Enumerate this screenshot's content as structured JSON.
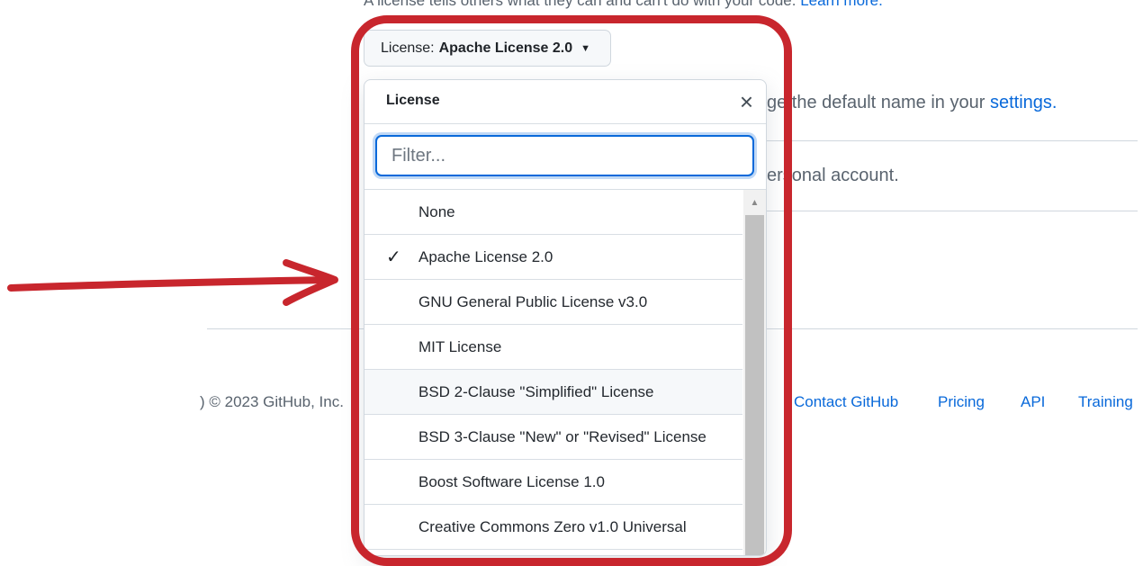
{
  "background": {
    "top_text": "A license tells others what they can and can't do with your code.",
    "top_link": "Learn more.",
    "line1_text": "ge the default name in your",
    "line1_link": "settings.",
    "line2_text": "ersonal account.",
    "footer": {
      "copyright": ") © 2023 GitHub, Inc.",
      "links": [
        "Contact GitHub",
        "Pricing",
        "API",
        "Training"
      ]
    }
  },
  "license_button": {
    "label": "License:",
    "value": "Apache License 2.0"
  },
  "dropdown": {
    "title": "License",
    "close_symbol": "×",
    "filter_placeholder": "Filter...",
    "check_symbol": "✓",
    "items": [
      {
        "label": "None",
        "selected": false
      },
      {
        "label": "Apache License 2.0",
        "selected": true
      },
      {
        "label": "GNU General Public License v3.0",
        "selected": false
      },
      {
        "label": "MIT License",
        "selected": false
      },
      {
        "label": "BSD 2-Clause \"Simplified\" License",
        "selected": false
      },
      {
        "label": "BSD 3-Clause \"New\" or \"Revised\" License",
        "selected": false
      },
      {
        "label": "Boost Software License 1.0",
        "selected": false
      },
      {
        "label": "Creative Commons Zero v1.0 Universal",
        "selected": false
      }
    ]
  },
  "colors": {
    "annotation_red": "#c8262d",
    "link_blue": "#0969da"
  }
}
